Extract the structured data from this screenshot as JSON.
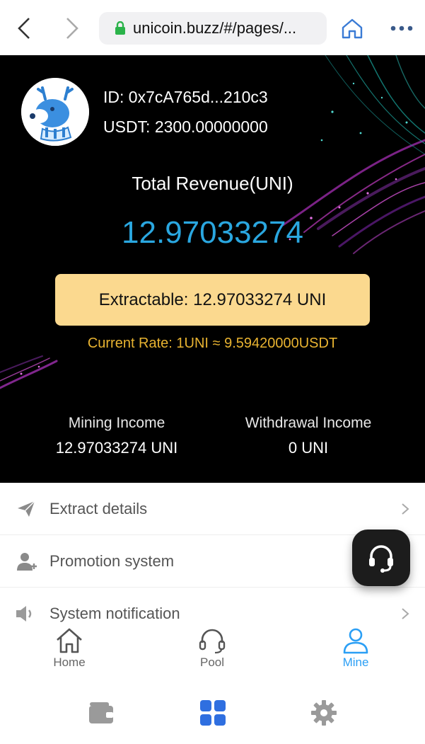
{
  "browser": {
    "url": "unicoin.buzz/#/pages/..."
  },
  "profile": {
    "id_text": "ID: 0x7cA765d...210c3",
    "usdt_text": "USDT: 2300.00000000"
  },
  "revenue": {
    "label": "Total Revenue(UNI)",
    "value": "12.97033274"
  },
  "extract": {
    "button_label": "Extractable: 12.97033274 UNI",
    "rate_text": "Current Rate: 1UNI ≈ 9.59420000USDT"
  },
  "stats": [
    {
      "label": "Mining Income",
      "value": "12.97033274 UNI"
    },
    {
      "label": "Withdrawal Income",
      "value": "0 UNI"
    }
  ],
  "menu": [
    {
      "label": "Extract details",
      "icon": "paper-plane-icon"
    },
    {
      "label": "Promotion system",
      "icon": "add-user-icon"
    },
    {
      "label": "System notification",
      "icon": "speaker-icon"
    }
  ],
  "tabs": [
    {
      "label": "Home",
      "icon": "home-icon",
      "active": false
    },
    {
      "label": "Pool",
      "icon": "headset-icon",
      "active": false
    },
    {
      "label": "Mine",
      "icon": "user-icon",
      "active": true
    }
  ],
  "colors": {
    "accent_blue": "#2aa7e0",
    "rate_gold": "#e8b331",
    "extract_bg": "#fbd98f",
    "tab_active": "#2b9ff5"
  }
}
